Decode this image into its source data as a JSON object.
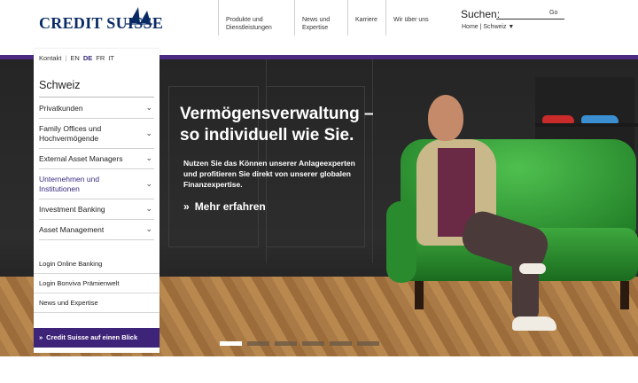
{
  "brand": {
    "logo_text": "CREDIT SUISSE"
  },
  "topnav": {
    "products": "Produkte und Dienstleistungen",
    "news": "News und Expertise",
    "careers": "Karriere",
    "about": "Wir über uns"
  },
  "search": {
    "label": "Suchen:",
    "go": "Go"
  },
  "breadcrumb": "Home | Schweiz ▼",
  "sidebar": {
    "lang": {
      "contact": "Kontakt",
      "en": "EN",
      "de": "DE",
      "fr": "FR",
      "it": "IT"
    },
    "title": "Schweiz",
    "items": [
      {
        "label": "Privatkunden"
      },
      {
        "label": "Family Offices und Hochvermögende"
      },
      {
        "label": "External Asset Managers"
      },
      {
        "label": "Unternehmen und Institutionen"
      },
      {
        "label": "Investment Banking"
      },
      {
        "label": "Asset Management"
      }
    ],
    "links": [
      {
        "label": "Login Online Banking"
      },
      {
        "label": "Login Bonviva Prämienwelt"
      },
      {
        "label": "News und Expertise"
      }
    ],
    "overview": "Credit Suisse auf einen Blick"
  },
  "hero": {
    "headline_1": "Vermögensverwaltung –",
    "headline_2": "so individuell wie Sie.",
    "sub": "Nutzen Sie das Können unserer Anlageexperten und profitieren Sie direkt von unserer globalen Finanzexpertise.",
    "cta": "Mehr erfahren",
    "carousel_total": 6,
    "carousel_active": 1
  },
  "colors": {
    "accent_purple": "#4a2a82",
    "brand_navy": "#0a2a66",
    "sofa_green": "#2a8a2e"
  },
  "icons": {
    "chevron": "chevron-down-icon",
    "arrow": "double-chevron-right-icon"
  }
}
